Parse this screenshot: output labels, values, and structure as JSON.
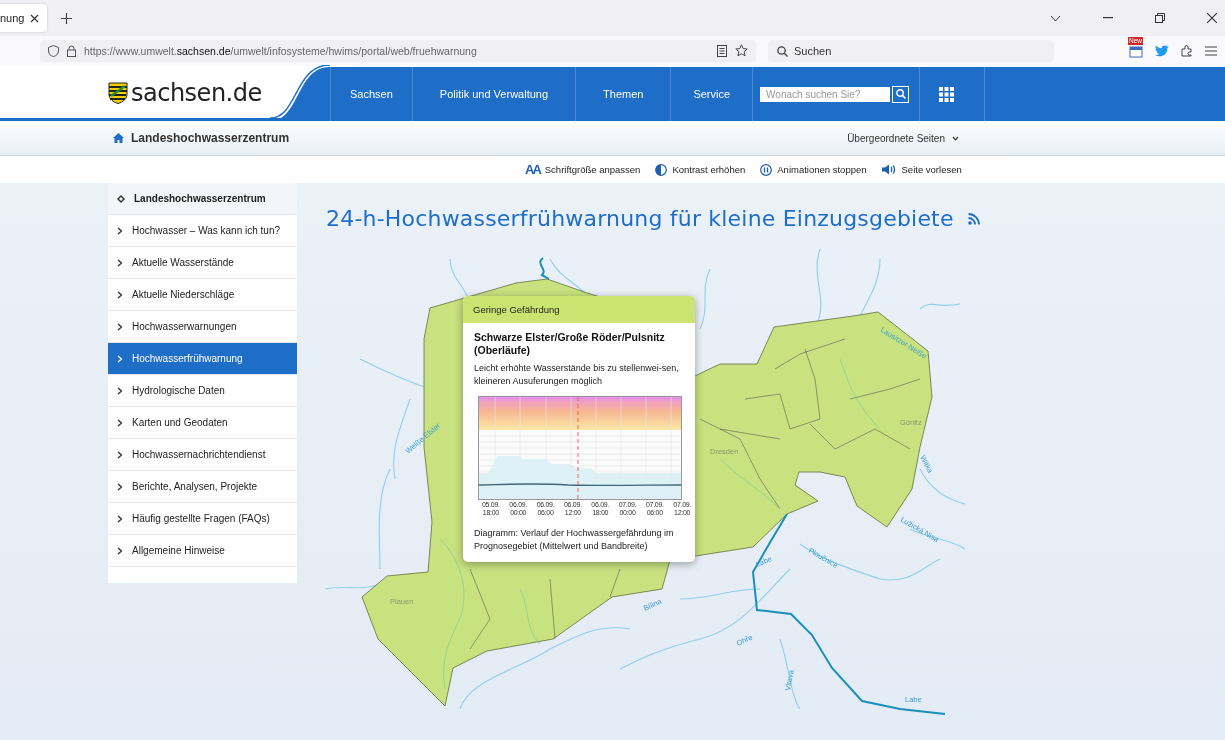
{
  "browser": {
    "tab_title": "nung",
    "url": "https://www.umwelt.**sachsen.de**/umwelt/infosysteme/hwims/portal/web/fruehwarnung",
    "search_placeholder": "Suchen",
    "badge": "New"
  },
  "header": {
    "logo": "sachsen.de",
    "nav": [
      {
        "label": "Sachsen"
      },
      {
        "label": "Politik und Verwaltung"
      },
      {
        "label": "Themen"
      },
      {
        "label": "Service"
      }
    ],
    "search_placeholder": "Wonach suchen Sie?"
  },
  "breadcrumb": {
    "label": "Landeshochwasserzentrum",
    "parent_pages": "Übergeordnete Seiten"
  },
  "tools": [
    {
      "kind": "font",
      "glyph": "AA",
      "label": "Schriftgröße anpassen"
    },
    {
      "kind": "contrast",
      "label": "Kontrast erhöhen"
    },
    {
      "kind": "pause",
      "label": "Animationen stoppen"
    },
    {
      "kind": "speaker",
      "label": "Seite vorlesen"
    }
  ],
  "sidebar": {
    "items": [
      {
        "kind": "root",
        "label": "Landeshochwasserzentrum",
        "selected": false
      },
      {
        "kind": "page",
        "label": "Hochwasser – Was kann ich tun?",
        "selected": false
      },
      {
        "kind": "page",
        "label": "Aktuelle Wasserstände",
        "selected": false
      },
      {
        "kind": "page",
        "label": "Aktuelle Niederschläge",
        "selected": false
      },
      {
        "kind": "page",
        "label": "Hochwasserwarnungen",
        "selected": false
      },
      {
        "kind": "page",
        "label": "Hochwasserfrühwarnung",
        "selected": true
      },
      {
        "kind": "page",
        "label": "Hydrologische Daten",
        "selected": false
      },
      {
        "kind": "page",
        "label": "Karten und Geodaten",
        "selected": false
      },
      {
        "kind": "page",
        "label": "Hochwassernachrichtendienst",
        "selected": false
      },
      {
        "kind": "page",
        "label": "Berichte, Analysen, Projekte",
        "selected": false
      },
      {
        "kind": "page",
        "label": "Häufig gestellte Fragen (FAQs)",
        "selected": false
      },
      {
        "kind": "page",
        "label": "Allgemeine Hinweise",
        "selected": false
      }
    ]
  },
  "title": "24-h-Hochwasserfrühwarnung für kleine Einzugsgebiete",
  "map": {
    "labels": [
      "Weiße Elster",
      "Plauen",
      "Dresden",
      "Görlitz",
      "Lausitzer Neiße",
      "Witka",
      "Lužická Nisa",
      "Ploučnice",
      "Labe",
      "Bílina",
      "Ohře",
      "Vltava",
      "Labe"
    ]
  },
  "popup": {
    "level": "Geringe Gefährdung",
    "color": "#cbe370",
    "region": "Schwarze Elster/Große Röder/Pulsnitz (Oberläufe)",
    "description": "Leicht erhöhte Wasserstände bis zu stellenwei-sen, kleineren Ausuferungen möglich",
    "time_labels": [
      {
        "date": "05.09.",
        "time": "18:00"
      },
      {
        "date": "06.09.",
        "time": "00:00"
      },
      {
        "date": "06.09.",
        "time": "06:00"
      },
      {
        "date": "06.09.",
        "time": "12:00"
      },
      {
        "date": "06.09.",
        "time": "18:00"
      },
      {
        "date": "07.09.",
        "time": "00:00"
      },
      {
        "date": "07.09.",
        "time": "06:00"
      },
      {
        "date": "07.09.",
        "time": "12:00"
      }
    ],
    "caption": "Diagramm: Verlauf der Hochwassergefährdung im Prognosegebiet (Mittelwert und Bandbreite)"
  }
}
